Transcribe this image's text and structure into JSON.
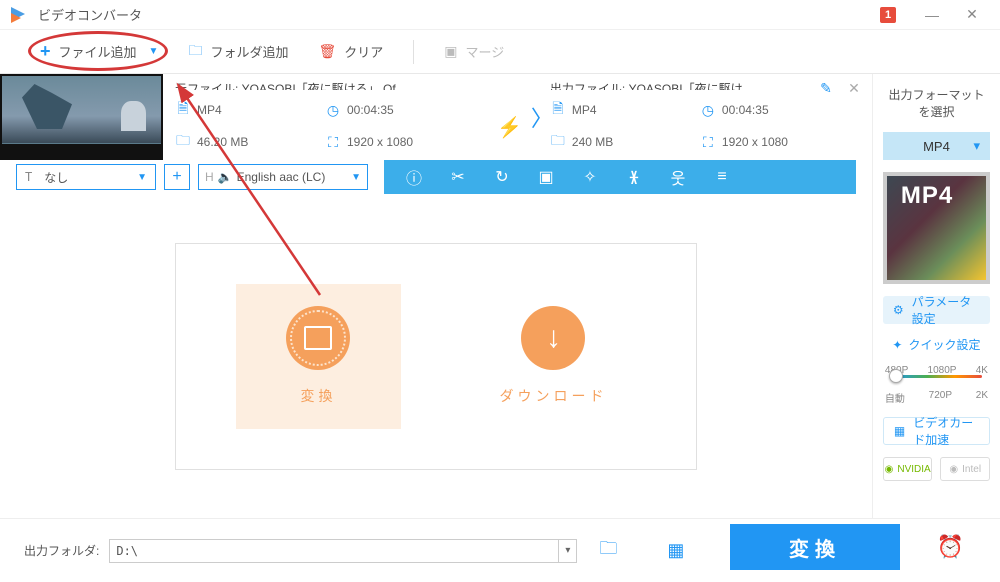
{
  "window": {
    "title": "ビデオコンバータ",
    "step_badge": "1"
  },
  "toolbar": {
    "add_file": "ファイル追加",
    "add_folder": "フォルダ追加",
    "clear": "クリア",
    "merge": "マージ"
  },
  "file": {
    "source": {
      "title": "元ファイル: YOASOBI「夜に駆ける」 Of...",
      "format": "MP4",
      "duration": "00:04:35",
      "size": "46.20 MB",
      "resolution": "1920 x 1080"
    },
    "output": {
      "title": "出力ファイル: YOASOBI「夜に駆け...",
      "format": "MP4",
      "duration": "00:04:35",
      "size": "240 MB",
      "resolution": "1920 x 1080"
    },
    "subtitle_label": "T",
    "subtitle": "なし",
    "audio_prefix": "H",
    "audio": "English aac (LC)"
  },
  "actions": {
    "convert": "変換",
    "download": "ダウンロード"
  },
  "sidebar": {
    "title": "出力フォーマットを選択",
    "format": "MP4",
    "thumb_label": "MP4",
    "params": "パラメータ設定",
    "quick": "クイック設定",
    "quality_top": {
      "a": "480P",
      "b": "1080P",
      "c": "4K"
    },
    "quality_bottom": {
      "a": "自動",
      "b": "720P",
      "c": "2K"
    },
    "gpu": "ビデオカード加速",
    "nvidia": "NVIDIA",
    "intel": "Intel"
  },
  "footer": {
    "label": "出力フォルダ:",
    "path": "D:\\",
    "convert": "変換"
  }
}
